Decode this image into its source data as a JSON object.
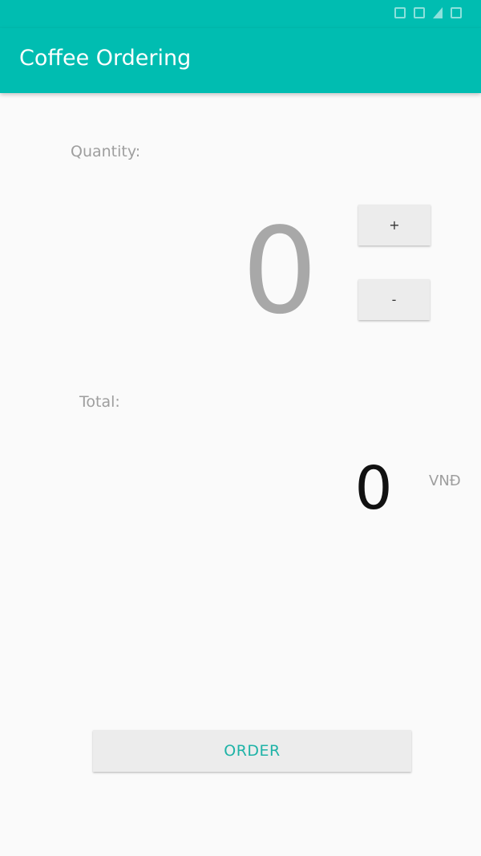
{
  "app": {
    "title": "Coffee Ordering"
  },
  "quantity": {
    "label": "Quantity:",
    "value": "0",
    "increment_label": "+",
    "decrement_label": "-"
  },
  "total": {
    "label": "Total:",
    "value": "0",
    "currency": "VNĐ"
  },
  "actions": {
    "order_label": "ORDER"
  },
  "colors": {
    "primary": "#00bdb1",
    "accent_text": "#1fb3a7",
    "background": "#fafafa",
    "button_bg": "#ececec",
    "muted_text": "#9e9e9e"
  },
  "icons": [
    "wifi-icon",
    "signal-icon",
    "battery-icon"
  ]
}
